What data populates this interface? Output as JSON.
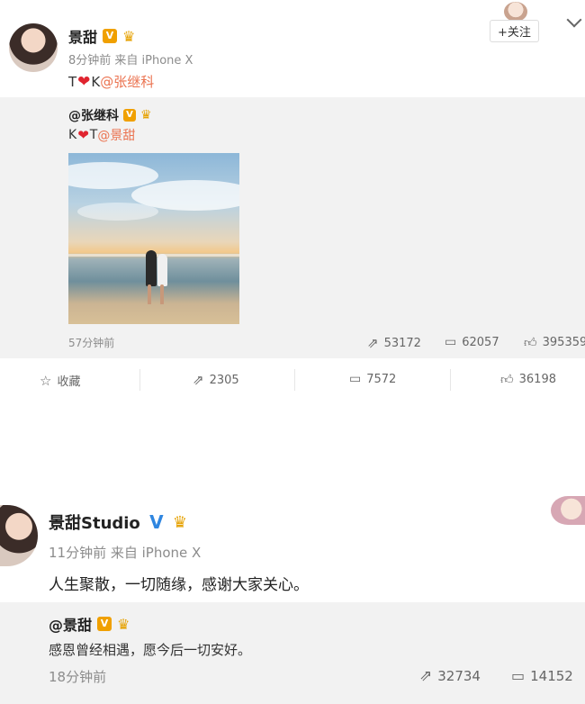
{
  "post1": {
    "username": "景甜",
    "time_source": "8分钟前 来自 iPhone X",
    "text_left": "T",
    "text_mid": "K",
    "mention": "@张继科",
    "follow_label": "+关注",
    "repost": {
      "username": "@张继科",
      "text_left": "K",
      "text_mid": "T",
      "mention": "@景甜",
      "time": "57分钟前",
      "reposts": "53172",
      "comments": "62057",
      "likes": "395359"
    },
    "actions": {
      "favorite": "收藏",
      "reposts": "2305",
      "comments": "7572",
      "likes": "36198"
    }
  },
  "post2": {
    "username": "景甜Studio",
    "time_source": "11分钟前 来自 iPhone X",
    "text": "人生聚散，一切随缘，感谢大家关心。",
    "repost": {
      "username": "@景甜",
      "text": "感恩曾经相遇，愿今后一切安好。",
      "time": "18分钟前",
      "reposts": "32734",
      "comments": "14152"
    }
  },
  "badges": {
    "v": "V"
  },
  "colors": {
    "mention": "#eb7350",
    "heart": "#e0242f",
    "verified_gold": "#f0a000",
    "verified_blue": "#2f86e0"
  }
}
